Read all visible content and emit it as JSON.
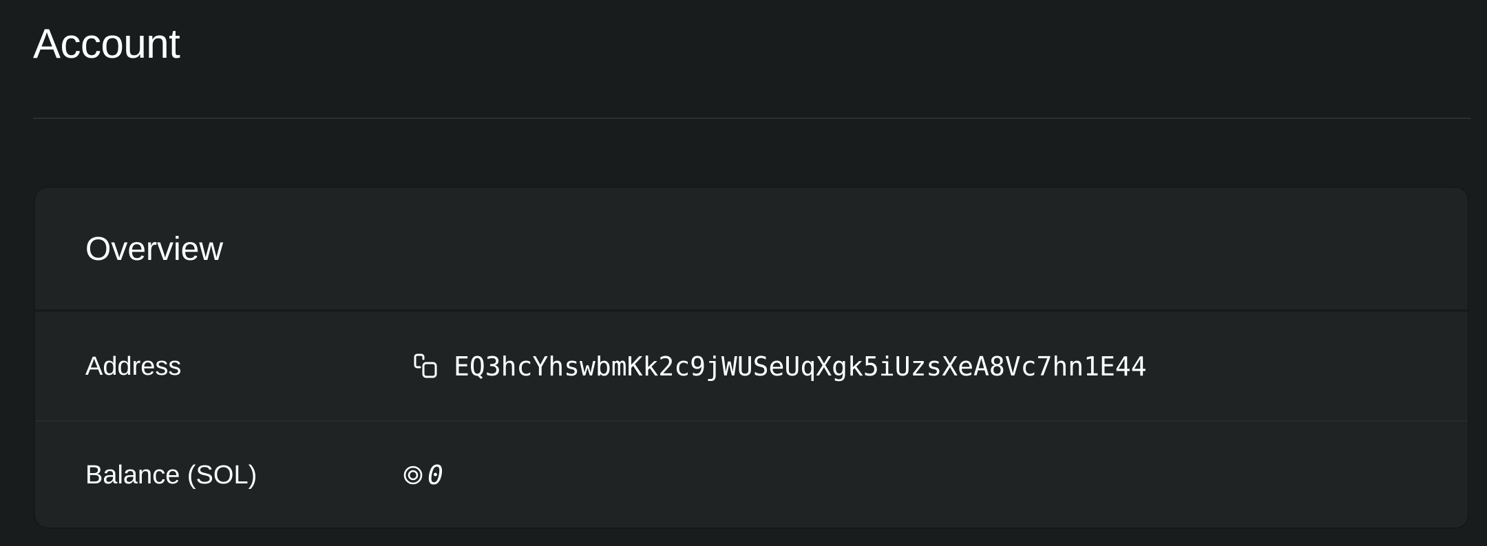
{
  "header": {
    "title": "Account"
  },
  "overview": {
    "title": "Overview",
    "rows": [
      {
        "label": "Address",
        "icon": "copy-icon",
        "value": "EQ3hcYhswbmKk2c9jWUSeUqXgk5iUzsXeA8Vc7hn1E44"
      },
      {
        "label": "Balance (SOL)",
        "icon": "sol-icon",
        "value": "0"
      }
    ]
  },
  "colors": {
    "background": "#181c1c",
    "card": "#1f2324",
    "text": "#ffffff"
  }
}
